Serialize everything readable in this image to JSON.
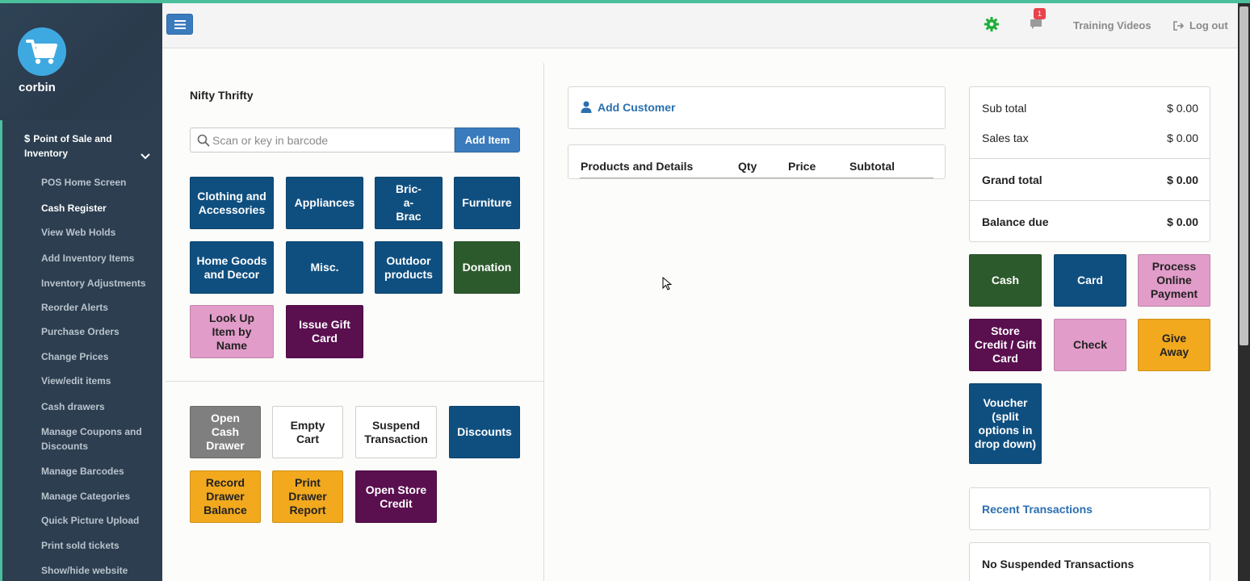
{
  "sidebar": {
    "username": "corbin",
    "section": {
      "icon": "dollar-icon",
      "label": "Point of Sale and Inventory"
    },
    "items": [
      {
        "label": "POS Home Screen"
      },
      {
        "label": "Cash Register",
        "active": true
      },
      {
        "label": "View Web Holds"
      },
      {
        "label": "Add Inventory Items"
      },
      {
        "label": "Inventory Adjustments"
      },
      {
        "label": "Reorder Alerts"
      },
      {
        "label": "Purchase Orders"
      },
      {
        "label": "Change Prices"
      },
      {
        "label": "View/edit items"
      },
      {
        "label": "Cash drawers"
      },
      {
        "label": "Manage Coupons and Discounts"
      },
      {
        "label": "Manage Barcodes"
      },
      {
        "label": "Manage Categories"
      },
      {
        "label": "Quick Picture Upload"
      },
      {
        "label": "Print sold tickets"
      },
      {
        "label": "Show/hide website items"
      }
    ]
  },
  "topbar": {
    "notification_count": "1",
    "training_label": "Training Videos",
    "logout_label": "Log out"
  },
  "pos": {
    "store_name": "Nifty Thrifty",
    "search": {
      "placeholder": "Scan or key in barcode",
      "value": ""
    },
    "add_item_label": "Add Item",
    "category_tiles": [
      {
        "label": "Clothing and Accessories",
        "color": "#0f4f80"
      },
      {
        "label": "Appliances",
        "color": "#0f4f80"
      },
      {
        "label": "Bric-a-Brac",
        "color": "#0f4f80"
      },
      {
        "label": "Furniture",
        "color": "#0f4f80"
      },
      {
        "label": "Home Goods and Decor",
        "color": "#0f4f80"
      },
      {
        "label": "Misc.",
        "color": "#0f4f80"
      },
      {
        "label": "Outdoor products",
        "color": "#0f4f80"
      },
      {
        "label": "Donation",
        "color": "#2d5a2c"
      },
      {
        "label": "Look Up Item by Name",
        "color": "#e29cc9"
      },
      {
        "label": "Issue Gift Card",
        "color": "#5a0f4f"
      }
    ],
    "action_tiles": [
      {
        "label": "Open Cash Drawer",
        "color": "#7f7f7f"
      },
      {
        "label": "Empty Cart",
        "color": "#ffffff"
      },
      {
        "label": "Suspend Transaction",
        "color": "#ffffff"
      },
      {
        "label": "Discounts",
        "color": "#0f4f80"
      },
      {
        "label": "Record Drawer Balance",
        "color": "#f2a91e"
      },
      {
        "label": "Print Drawer Report",
        "color": "#f2a91e"
      },
      {
        "label": "Open Store Credit",
        "color": "#5a0f4f"
      }
    ]
  },
  "cart": {
    "add_customer_label": "Add Customer",
    "columns": [
      "Products and Details",
      "Qty",
      "Price",
      "Subtotal"
    ],
    "rows": []
  },
  "totals": {
    "sub_total_label": "Sub total",
    "sub_total": "$ 0.00",
    "sales_tax_label": "Sales tax",
    "sales_tax": "$ 0.00",
    "grand_total_label": "Grand total",
    "grand_total": "$ 0.00",
    "balance_due_label": "Balance due",
    "balance_due": "$ 0.00"
  },
  "payment_tiles": [
    {
      "label": "Cash",
      "color": "#2d5a2c"
    },
    {
      "label": "Card",
      "color": "#0f4f80"
    },
    {
      "label": "Process Online Payment",
      "color": "#e29cc9"
    },
    {
      "label": "Store Credit / Gift Card",
      "color": "#5a0f4f"
    },
    {
      "label": "Check",
      "color": "#e29cc9"
    },
    {
      "label": "Give Away",
      "color": "#f2a91e"
    },
    {
      "label": "Voucher (split options in drop down)",
      "color": "#0f4f80"
    }
  ],
  "recent_transactions_label": "Recent Transactions",
  "suspended_label": "No Suspended Transactions",
  "colors": {
    "accent": "#4bbf9b",
    "primary": "#3a7bbd",
    "link": "#2a6fb0",
    "sidebar": "#2c3e50"
  }
}
